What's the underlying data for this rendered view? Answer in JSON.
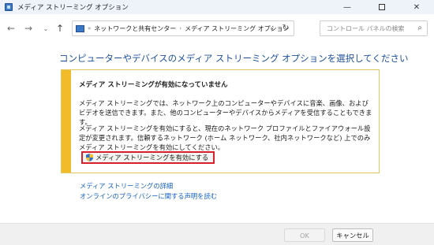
{
  "window": {
    "title": "メディア ストリーミング オプション",
    "minimize": "—",
    "close": "✕"
  },
  "nav": {
    "back_icon": "←",
    "forward_icon": "→",
    "dropdown_icon": "⌄",
    "up_icon": "↑",
    "breadcrumb_sep": "«",
    "breadcrumb": [
      "ネットワークと共有センター",
      "メディア ストリーミング オプション"
    ],
    "crumb_arrow": "›",
    "chevron_icon": "⌄",
    "refresh_icon": "↻",
    "search_placeholder": "コントロール パネルの検索",
    "search_icon": "⌕"
  },
  "main": {
    "heading": "コンピューターやデバイスのメディア ストリーミング オプションを選択してください",
    "infobox": {
      "title": "メディア ストリーミングが有効になっていません",
      "para1": "メディア ストリーミングでは、ネットワーク上のコンピューターやデバイスに音楽、画像、およびビデオを送信できます。また、他のコンピューターやデバイスからメディアを受信することもできます。",
      "para2": "メディア ストリーミングを有効にすると、現在のネットワーク プロファイルとファイアウォール設定が変更されます。信頼するネットワーク (ホーム ネットワーク、社内ネットワークなど) 上でのみメディア ストリーミングを有効にしてください。",
      "enable_button": "メディア ストリーミングを有効にする"
    },
    "links": {
      "details": "メディア ストリーミングの詳細",
      "privacy": "オンラインのプライバシーに関する声明を読む"
    }
  },
  "footer": {
    "ok_label": "OK",
    "cancel_label": "キャンセル"
  },
  "colors": {
    "accent_link": "#1660c6",
    "heading": "#1c4f9c",
    "warning_stripe": "#f2bb2a",
    "highlight_border": "#d8202a"
  }
}
